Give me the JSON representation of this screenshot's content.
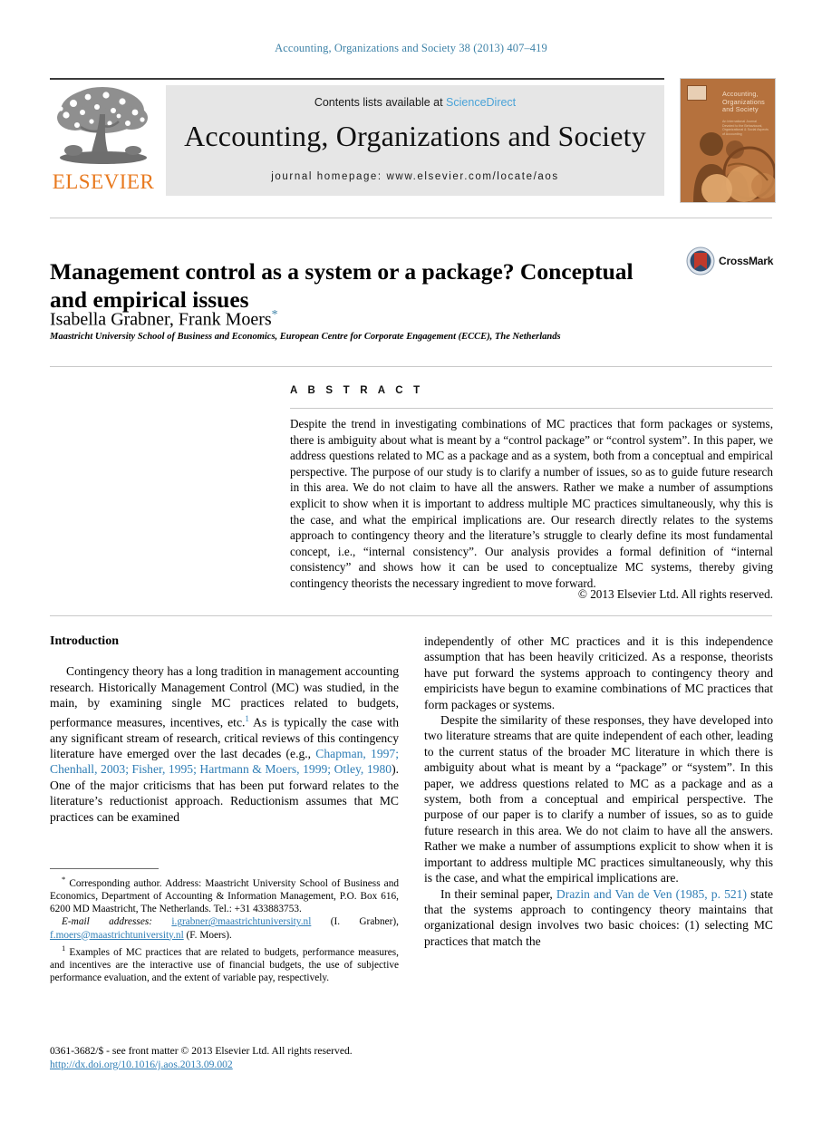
{
  "running_head": "Accounting, Organizations and Society 38 (2013) 407–419",
  "masthead": {
    "contents_prefix": "Contents lists available at ",
    "sciencedirect": "ScienceDirect",
    "journal_title": "Accounting, Organizations and Society",
    "homepage": "journal homepage: www.elsevier.com/locate/aos",
    "publisher_logo_text": "ELSEVIER",
    "publisher_logo_icon": "elsevier-tree-icon",
    "cover": {
      "title_line1": "Accounting,",
      "title_line2": "Organizations",
      "title_line3": "and Society",
      "sub_line1": "An International Journal",
      "sub_line2": "Devoted to the Behavioural,",
      "sub_line3": "Organizational & Social Aspects",
      "sub_line4": "of Accounting"
    }
  },
  "article": {
    "title": "Management control as a system or a package? Conceptual and empirical issues",
    "crossmark_label": "CrossMark",
    "crossmark_icon": "crossmark-shield-icon",
    "authors": "Isabella Grabner, Frank Moers",
    "corresponding_marker": "*",
    "affiliation": "Maastricht University School of Business and Economics, European Centre for Corporate Engagement (ECCE), The Netherlands"
  },
  "abstract": {
    "heading": "A B S T R A C T",
    "body": "Despite the trend in investigating combinations of MC practices that form packages or systems, there is ambiguity about what is meant by a “control package” or “control system”. In this paper, we address questions related to MC as a package and as a system, both from a conceptual and empirical perspective. The purpose of our study is to clarify a number of issues, so as to guide future research in this area. We do not claim to have all the answers. Rather we make a number of assumptions explicit to show when it is important to address multiple MC practices simultaneously, why this is the case, and what the empirical implications are. Our research directly relates to the systems approach to contingency theory and the literature’s struggle to clearly define its most fundamental concept, i.e., “internal consistency”. Our analysis provides a formal definition of “internal consistency” and shows how it can be used to conceptualize MC systems, thereby giving contingency theorists the necessary ingredient to move forward.",
    "copyright": "© 2013 Elsevier Ltd. All rights reserved."
  },
  "body": {
    "section_heading": "Introduction",
    "left_col": {
      "p1_a": "Contingency theory has a long tradition in management accounting research. Historically Management Control (MC) was studied, in the main, by examining single MC practices related to budgets, performance measures, incentives, etc.",
      "p1_footnote_marker": "1",
      "p1_b": " As is typically the case with any significant stream of research, critical reviews of this contingency literature have emerged over the last decades (e.g., ",
      "p1_refs": "Chapman, 1997; Chenhall, 2003; Fisher, 1995; Hartmann & Moers, 1999; Otley, 1980",
      "p1_c": "). One of the major criticisms that has been put forward relates to the literature’s reductionist approach. Reductionism assumes that MC practices can be examined"
    },
    "right_col": {
      "p1": "independently of other MC practices and it is this independence assumption that has been heavily criticized. As a response, theorists have put forward the systems approach to contingency theory and empiricists have begun to examine combinations of MC practices that form packages or systems.",
      "p2": "Despite the similarity of these responses, they have developed into two literature streams that are quite independent of each other, leading to the current status of the broader MC literature in which there is ambiguity about what is meant by a “package” or “system”. In this paper, we address questions related to MC as a package and as a system, both from a conceptual and empirical perspective. The purpose of our paper is to clarify a number of issues, so as to guide future research in this area. We do not claim to have all the answers. Rather we make a number of assumptions explicit to show when it is important to address multiple MC practices simultaneously, why this is the case, and what the empirical implications are.",
      "p3_a": "In their seminal paper, ",
      "p3_ref": "Drazin and Van de Ven (1985, p. 521)",
      "p3_b": " state that the systems approach to contingency theory maintains that organizational design involves two basic choices: (1) selecting MC practices that match the"
    }
  },
  "footnotes": {
    "corresponding_marker": "*",
    "corresponding": " Corresponding author. Address: Maastricht University School of Business and Economics, Department of Accounting & Information Management, P.O. Box 616, 6200 MD Maastricht, The Netherlands. Tel.: +31 433883753.",
    "email_label": "E-mail addresses:",
    "email_1": "i.grabner@maastrichtuniversity.nl",
    "email_1_owner": " (I. Grabner), ",
    "email_2": "f.moers@maastrichtuniversity.nl",
    "email_2_owner": " (F. Moers).",
    "fn1_marker": "1",
    "fn1": " Examples of MC practices that are related to budgets, performance measures, and incentives are the interactive use of financial budgets, the use of subjective performance evaluation, and the extent of variable pay, respectively."
  },
  "imprint": {
    "line1": "0361-3682/$ - see front matter © 2013 Elsevier Ltd. All rights reserved.",
    "doi": "http://dx.doi.org/10.1016/j.aos.2013.09.002"
  },
  "colors": {
    "link_blue": "#2e7db5",
    "running_head_blue": "#3f83a8",
    "sciencedirect_blue": "#4aa3d8",
    "elsevier_orange": "#e8791e",
    "band_grey": "#e6e6e6",
    "cover_brown": "#b5713d"
  }
}
